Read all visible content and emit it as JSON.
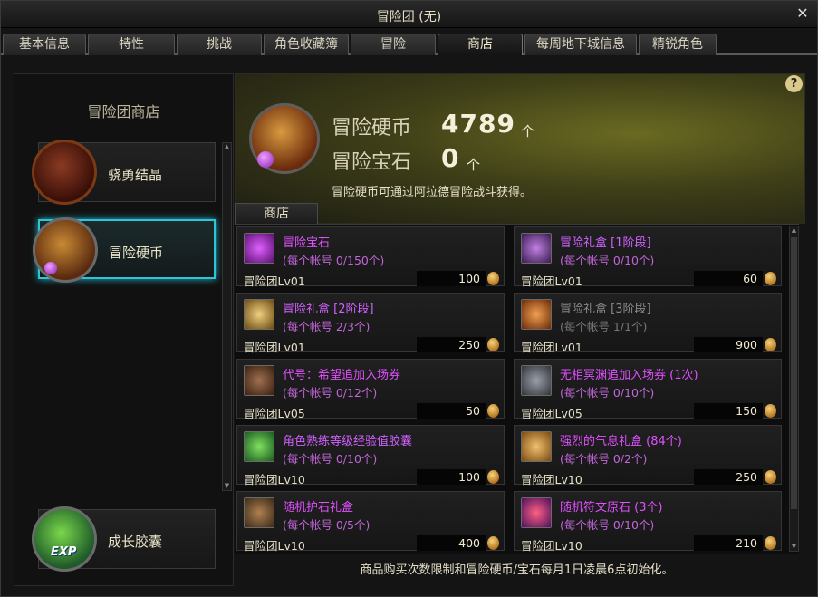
{
  "window": {
    "title": "冒险团 (无)",
    "close_glyph": "✕"
  },
  "tabs": [
    {
      "label": "基本信息"
    },
    {
      "label": "特性"
    },
    {
      "label": "挑战"
    },
    {
      "label": "角色收藏簿"
    },
    {
      "label": "冒险"
    },
    {
      "label": "商店",
      "active": true
    },
    {
      "label": "每周地下城信息"
    },
    {
      "label": "精锐角色"
    }
  ],
  "left_panel": {
    "heading": "冒险团商店",
    "categories": [
      {
        "label": "骁勇结晶",
        "icon": "valor-crystal-icon"
      },
      {
        "label": "冒险硬币",
        "icon": "treasure-chest-icon",
        "selected": true
      },
      {
        "label": "成长胶囊",
        "icon": "exp-capsule-icon"
      }
    ]
  },
  "header": {
    "help_glyph": "?",
    "currency1": {
      "label": "冒险硬币",
      "value": "4789",
      "unit": "个"
    },
    "currency2": {
      "label": "冒险宝石",
      "value": "0",
      "unit": "个"
    },
    "note": "冒险硬币可通过阿拉德冒险战斗获得。",
    "exp_text": "EXP"
  },
  "shop_tab": "商店",
  "items": [
    {
      "name": "冒险宝石",
      "limit": "(每个帐号 0/150个)",
      "level": "冒险团Lv01",
      "price": "100",
      "icon": "gem-icon",
      "name_color": "#e050ff"
    },
    {
      "name": "冒险礼盒 [1阶段]",
      "limit": "(每个帐号 0/10个)",
      "level": "冒险团Lv01",
      "price": "60",
      "icon": "gift-box-icon",
      "name_color": "#d060ff"
    },
    {
      "name": "冒险礼盒 [2阶段]",
      "limit": "(每个帐号 2/3个)",
      "level": "冒险团Lv01",
      "price": "250",
      "icon": "gift-box-icon",
      "name_color": "#d060ff"
    },
    {
      "name": "冒险礼盒 [3阶段]",
      "limit": "(每个帐号 1/1个)",
      "level": "冒险团Lv01",
      "price": "900",
      "icon": "gift-box-icon",
      "name_color": "#8a8a8a",
      "grayed": true
    },
    {
      "name": "代号：希望追加入场券",
      "limit": "(每个帐号 0/12个)",
      "level": "冒险团Lv05",
      "price": "50",
      "icon": "ticket-icon",
      "name_color": "#e050ff"
    },
    {
      "name": "无相冥渊追加入场券 (1次)",
      "limit": "(每个帐号 0/10个)",
      "level": "冒险团Lv05",
      "price": "150",
      "icon": "ticket-icon",
      "name_color": "#e050ff"
    },
    {
      "name": "角色熟练等级经验值胶囊",
      "limit": "(每个帐号 0/10个)",
      "level": "冒险团Lv10",
      "price": "100",
      "icon": "exp-capsule-icon",
      "name_color": "#d060ff"
    },
    {
      "name": "强烈的气息礼盒 (84个)",
      "limit": "(每个帐号 0/2个)",
      "level": "冒险团Lv10",
      "price": "250",
      "icon": "gift-box-icon",
      "name_color": "#e050ff"
    },
    {
      "name": "随机护石礼盒",
      "limit": "(每个帐号 0/5个)",
      "level": "冒险团Lv10",
      "price": "400",
      "icon": "talisman-box-icon",
      "name_color": "#e050ff"
    },
    {
      "name": "随机符文原石 (3个)",
      "limit": "(每个帐号 0/10个)",
      "level": "冒险团Lv10",
      "price": "210",
      "icon": "rune-stone-icon",
      "name_color": "#e050ff"
    }
  ],
  "footer": "商品购买次数限制和冒险硬币/宝石每月1日凌晨6点初始化。"
}
